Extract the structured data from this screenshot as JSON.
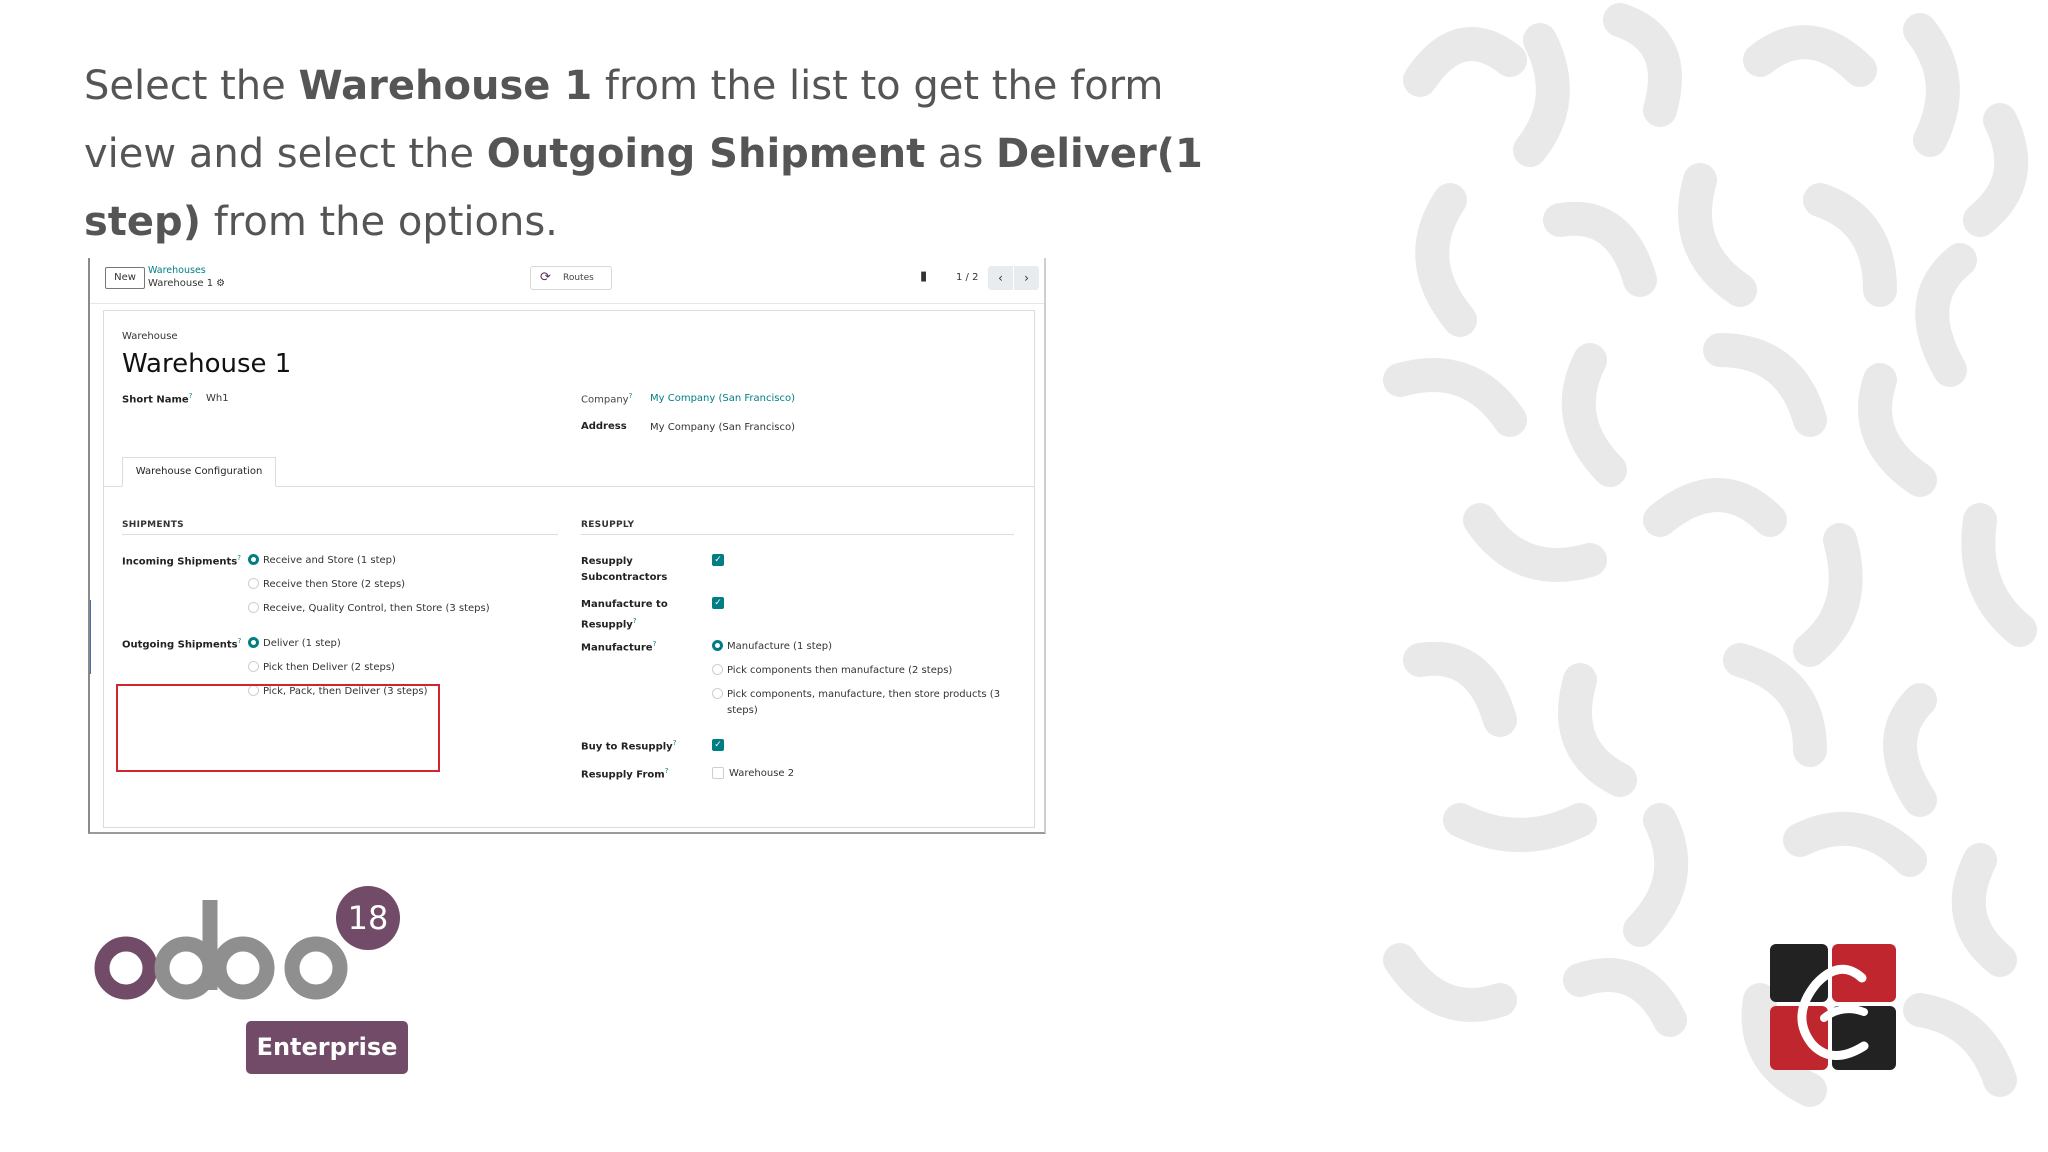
{
  "instruction": {
    "t1": "Select the ",
    "b1": "Warehouse 1",
    "t2": " from the list to get the form view and select the ",
    "b2": "Outgoing Shipment",
    "t3": " as ",
    "b3": "Deliver(1 step)",
    "t4": " from the options."
  },
  "control_panel": {
    "new_label": "New",
    "breadcrumb_parent": "Warehouses",
    "breadcrumb_current": "Warehouse 1",
    "routes_label": "Routes",
    "pager": "1 / 2"
  },
  "form": {
    "caption": "Warehouse",
    "title": "Warehouse 1",
    "short_name_label": "Short Name",
    "short_name_value": "Wh1",
    "company_label": "Company",
    "company_value": "My Company (San Francisco)",
    "address_label": "Address",
    "address_value": "My Company (San Francisco)",
    "tab_label": "Warehouse Configuration",
    "shipments": {
      "section": "SHIPMENTS",
      "incoming_label": "Incoming Shipments",
      "incoming_options": [
        "Receive and Store (1 step)",
        "Receive then Store (2 steps)",
        "Receive, Quality Control, then Store (3 steps)"
      ],
      "incoming_selected": 0,
      "outgoing_label": "Outgoing Shipments",
      "outgoing_options": [
        "Deliver (1 step)",
        "Pick then Deliver (2 steps)",
        "Pick, Pack, then Deliver (3 steps)"
      ],
      "outgoing_selected": 0
    },
    "resupply": {
      "section": "RESUPPLY",
      "resupply_sub_label_1": "Resupply",
      "resupply_sub_label_2": "Subcontractors",
      "resupply_sub_checked": true,
      "mto_label_1": "Manufacture to",
      "mto_label_2": "Resupply",
      "mto_checked": true,
      "manufacture_label": "Manufacture",
      "manufacture_options": [
        "Manufacture (1 step)",
        "Pick components then manufacture (2 steps)",
        "Pick components, manufacture, then store products (3",
        "steps)"
      ],
      "manufacture_selected": 0,
      "buy_label": "Buy to Resupply",
      "buy_checked": true,
      "resupply_from_label": "Resupply From",
      "resupply_from_value": "Warehouse 2",
      "resupply_from_checked": false
    }
  },
  "branding": {
    "odoo_version": "18",
    "enterprise_label": "Enterprise",
    "odoo_color": "#714b67",
    "accent_color": "#017e84",
    "highlight_color": "#d1242f"
  }
}
